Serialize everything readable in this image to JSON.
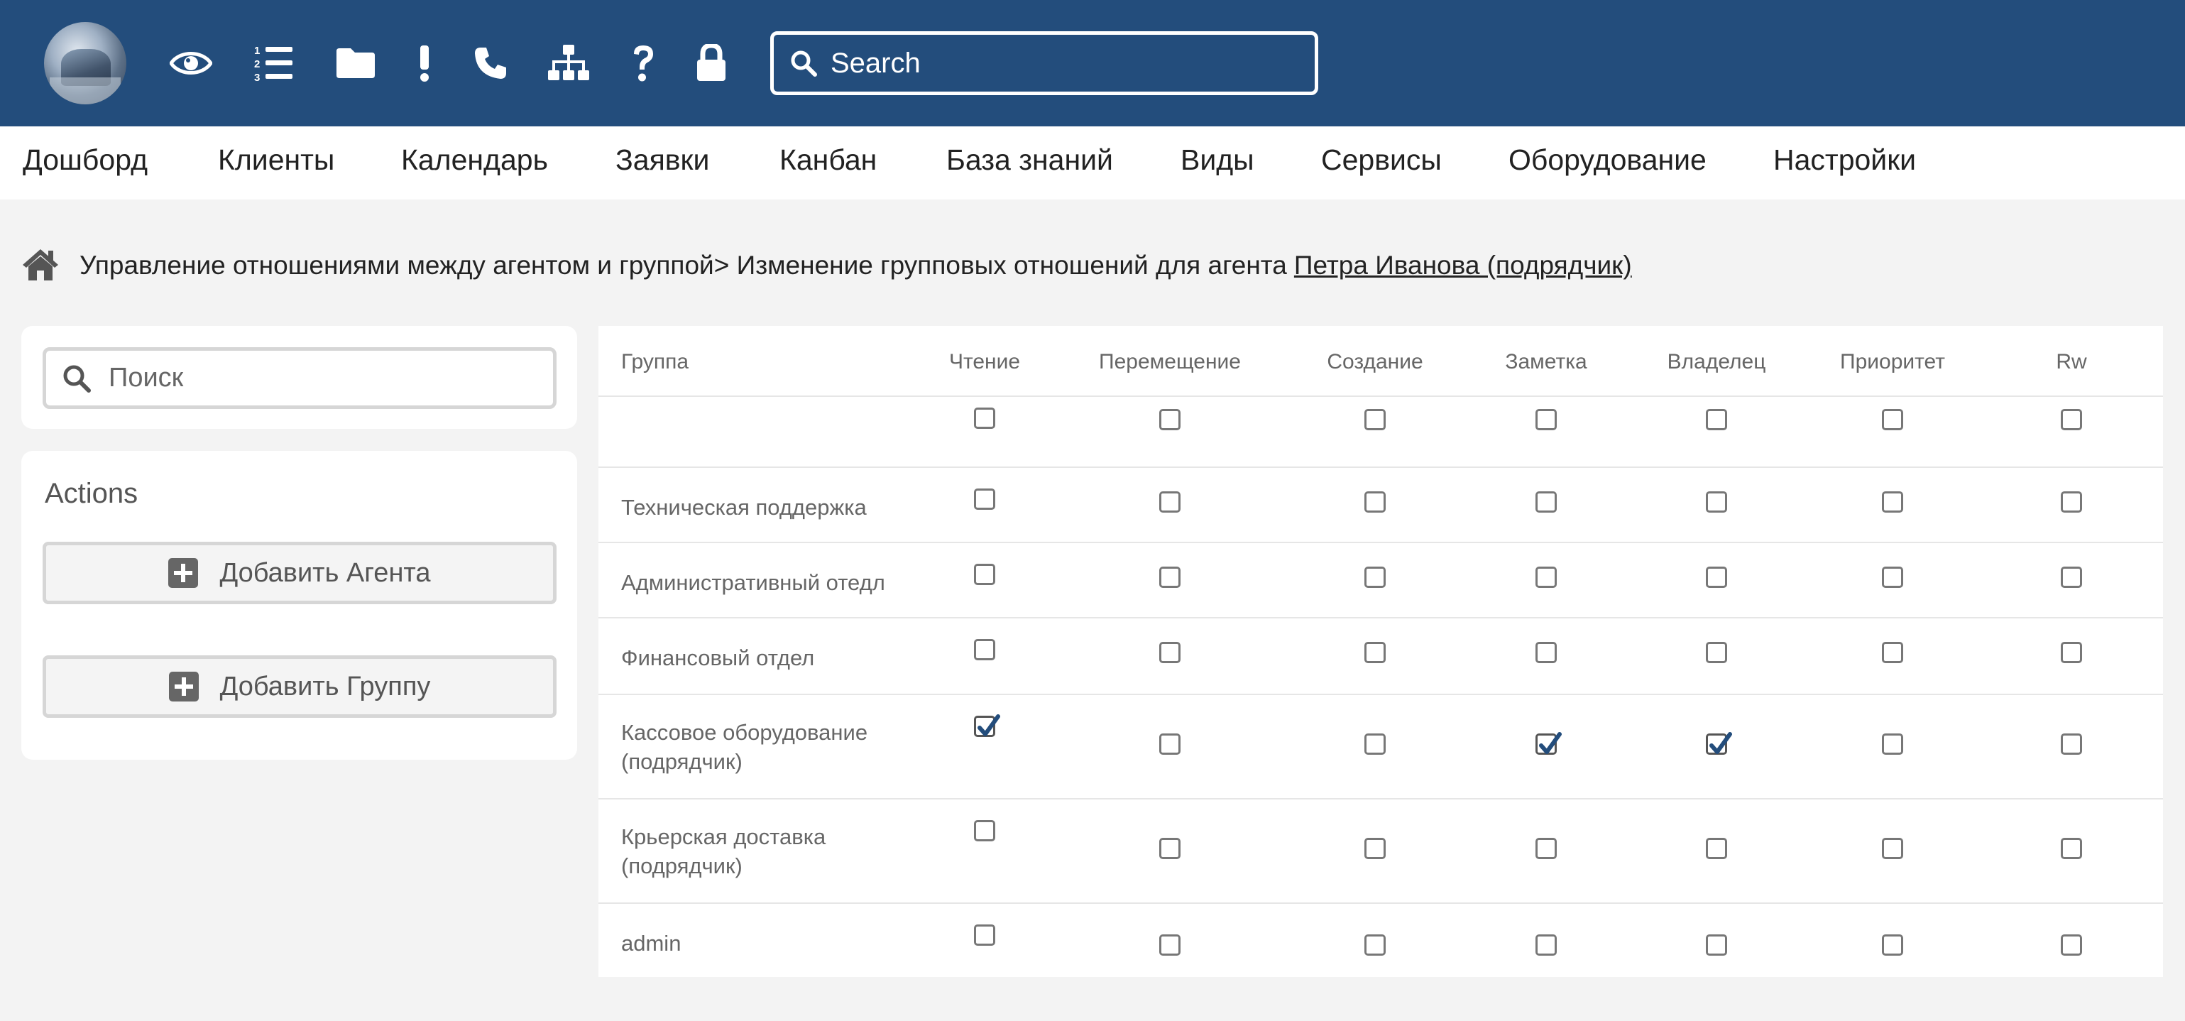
{
  "topbar": {
    "icons": [
      "eye-icon",
      "numbered-list-icon",
      "folder-icon",
      "exclamation-icon",
      "phone-icon",
      "sitemap-icon",
      "question-icon",
      "lock-icon"
    ],
    "search_placeholder": "Search",
    "color": "#234d7c"
  },
  "nav": {
    "items": [
      "Дошборд",
      "Клиенты",
      "Календарь",
      "Заявки",
      "Канбан",
      "База знаний",
      "Виды",
      "Сервисы",
      "Оборудование",
      "Настройки"
    ]
  },
  "breadcrumb": {
    "text": "Управление отношениями между агентом и группой> Изменение групповых отношений для агента",
    "link": "Петра Иванова (подрядчик)"
  },
  "sidebar": {
    "search_placeholder": "Поиск",
    "actions_title": "Actions",
    "buttons": [
      "Добавить Агента",
      "Добавить Группу"
    ]
  },
  "table": {
    "headers": [
      "Группа",
      "Чтение",
      "Перемещение",
      "Создание",
      "Заметка",
      "Владелец",
      "Приоритет",
      "Rw"
    ],
    "select_all": [
      false,
      false,
      false,
      false,
      false,
      false,
      false
    ],
    "rows": [
      {
        "group": "Техническая поддержка",
        "perms": [
          false,
          false,
          false,
          false,
          false,
          false,
          false
        ]
      },
      {
        "group": "Административный отедл",
        "perms": [
          false,
          false,
          false,
          false,
          false,
          false,
          false
        ]
      },
      {
        "group": "Финансовый отдел",
        "perms": [
          false,
          false,
          false,
          false,
          false,
          false,
          false
        ]
      },
      {
        "group": "Кассовое оборудование (подрядчик)",
        "perms": [
          true,
          false,
          false,
          true,
          true,
          false,
          false
        ]
      },
      {
        "group": "Крьерская доставка (подрядчик)",
        "perms": [
          false,
          false,
          false,
          false,
          false,
          false,
          false
        ]
      },
      {
        "group": "admin",
        "perms": [
          false,
          false,
          false,
          false,
          false,
          false,
          false
        ]
      }
    ]
  }
}
